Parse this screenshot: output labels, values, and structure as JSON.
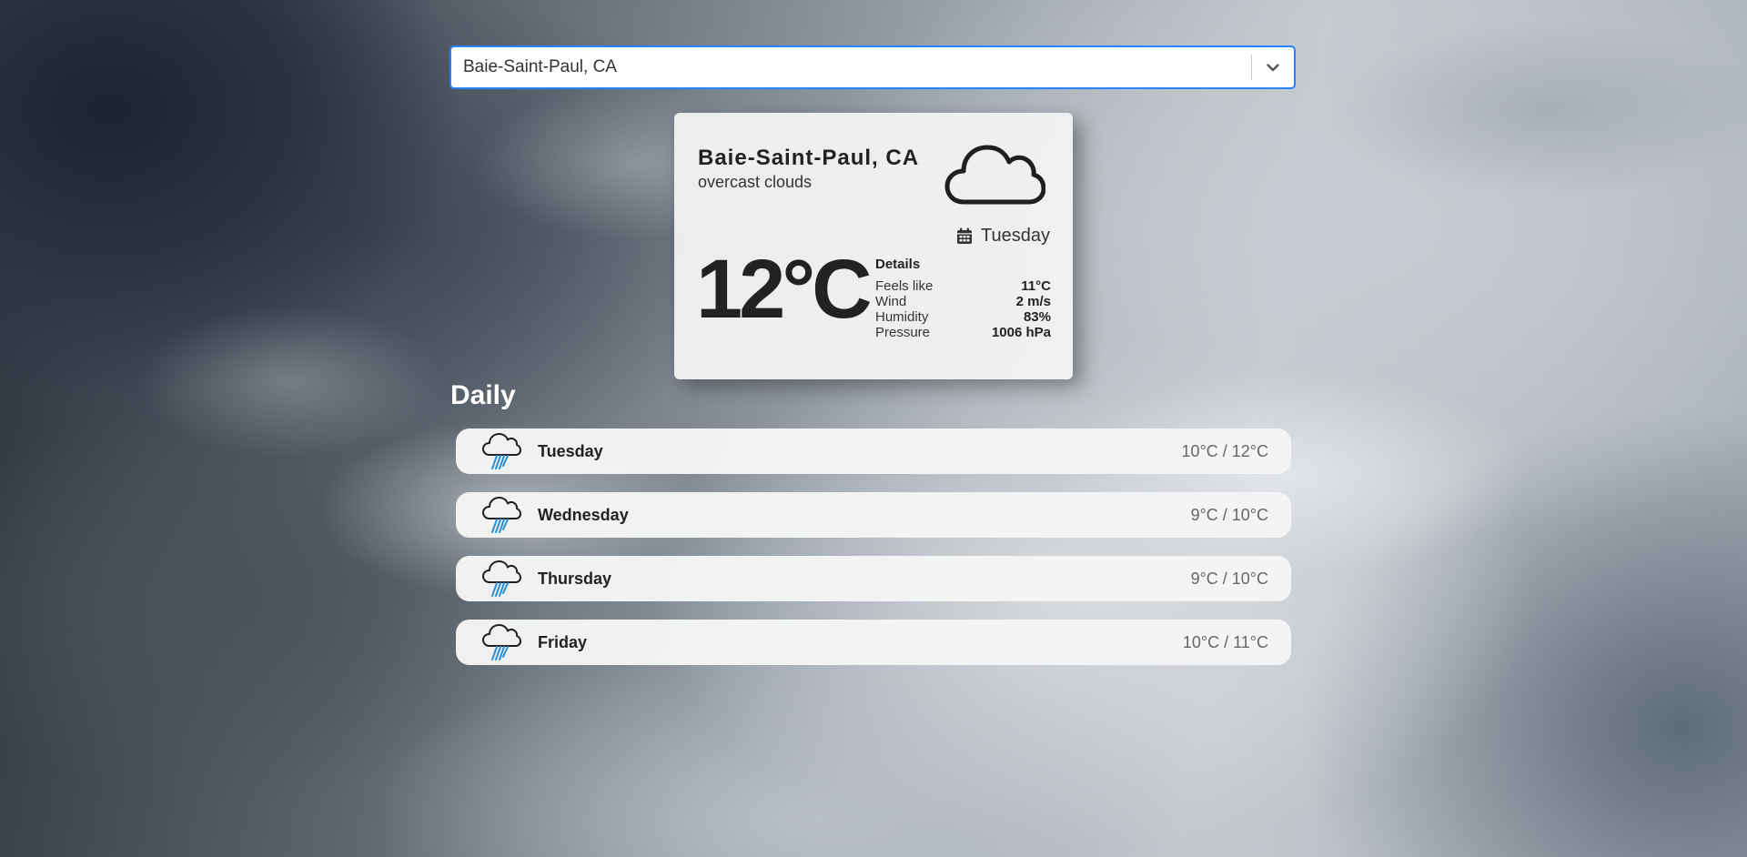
{
  "location_select": {
    "value": "Baie-Saint-Paul, CA",
    "indicator_icon": "chevron-down-icon",
    "border_color": "#2684ff"
  },
  "current": {
    "city": "Baie-Saint-Paul, CA",
    "description": "overcast clouds",
    "condition_icon": "cloud-icon",
    "day": "Tuesday",
    "day_icon": "calendar-icon",
    "temperature": "12°C",
    "details_title": "Details",
    "details": [
      {
        "label": "Feels like",
        "value": "11°C"
      },
      {
        "label": "Wind",
        "value": "2 m/s"
      },
      {
        "label": "Humidity",
        "value": "83%"
      },
      {
        "label": "Pressure",
        "value": "1006 hPa"
      }
    ]
  },
  "daily": {
    "title": "Daily",
    "items": [
      {
        "day": "Tuesday",
        "temps": "10°C / 12°C",
        "icon": "rain-cloud-icon"
      },
      {
        "day": "Wednesday",
        "temps": "9°C / 10°C",
        "icon": "rain-cloud-icon"
      },
      {
        "day": "Thursday",
        "temps": "9°C / 10°C",
        "icon": "rain-cloud-icon"
      },
      {
        "day": "Friday",
        "temps": "10°C / 11°C",
        "icon": "rain-cloud-icon"
      }
    ]
  },
  "colors": {
    "rain_drops": "#2b8fd6",
    "icon_stroke": "#1f1f1f"
  }
}
